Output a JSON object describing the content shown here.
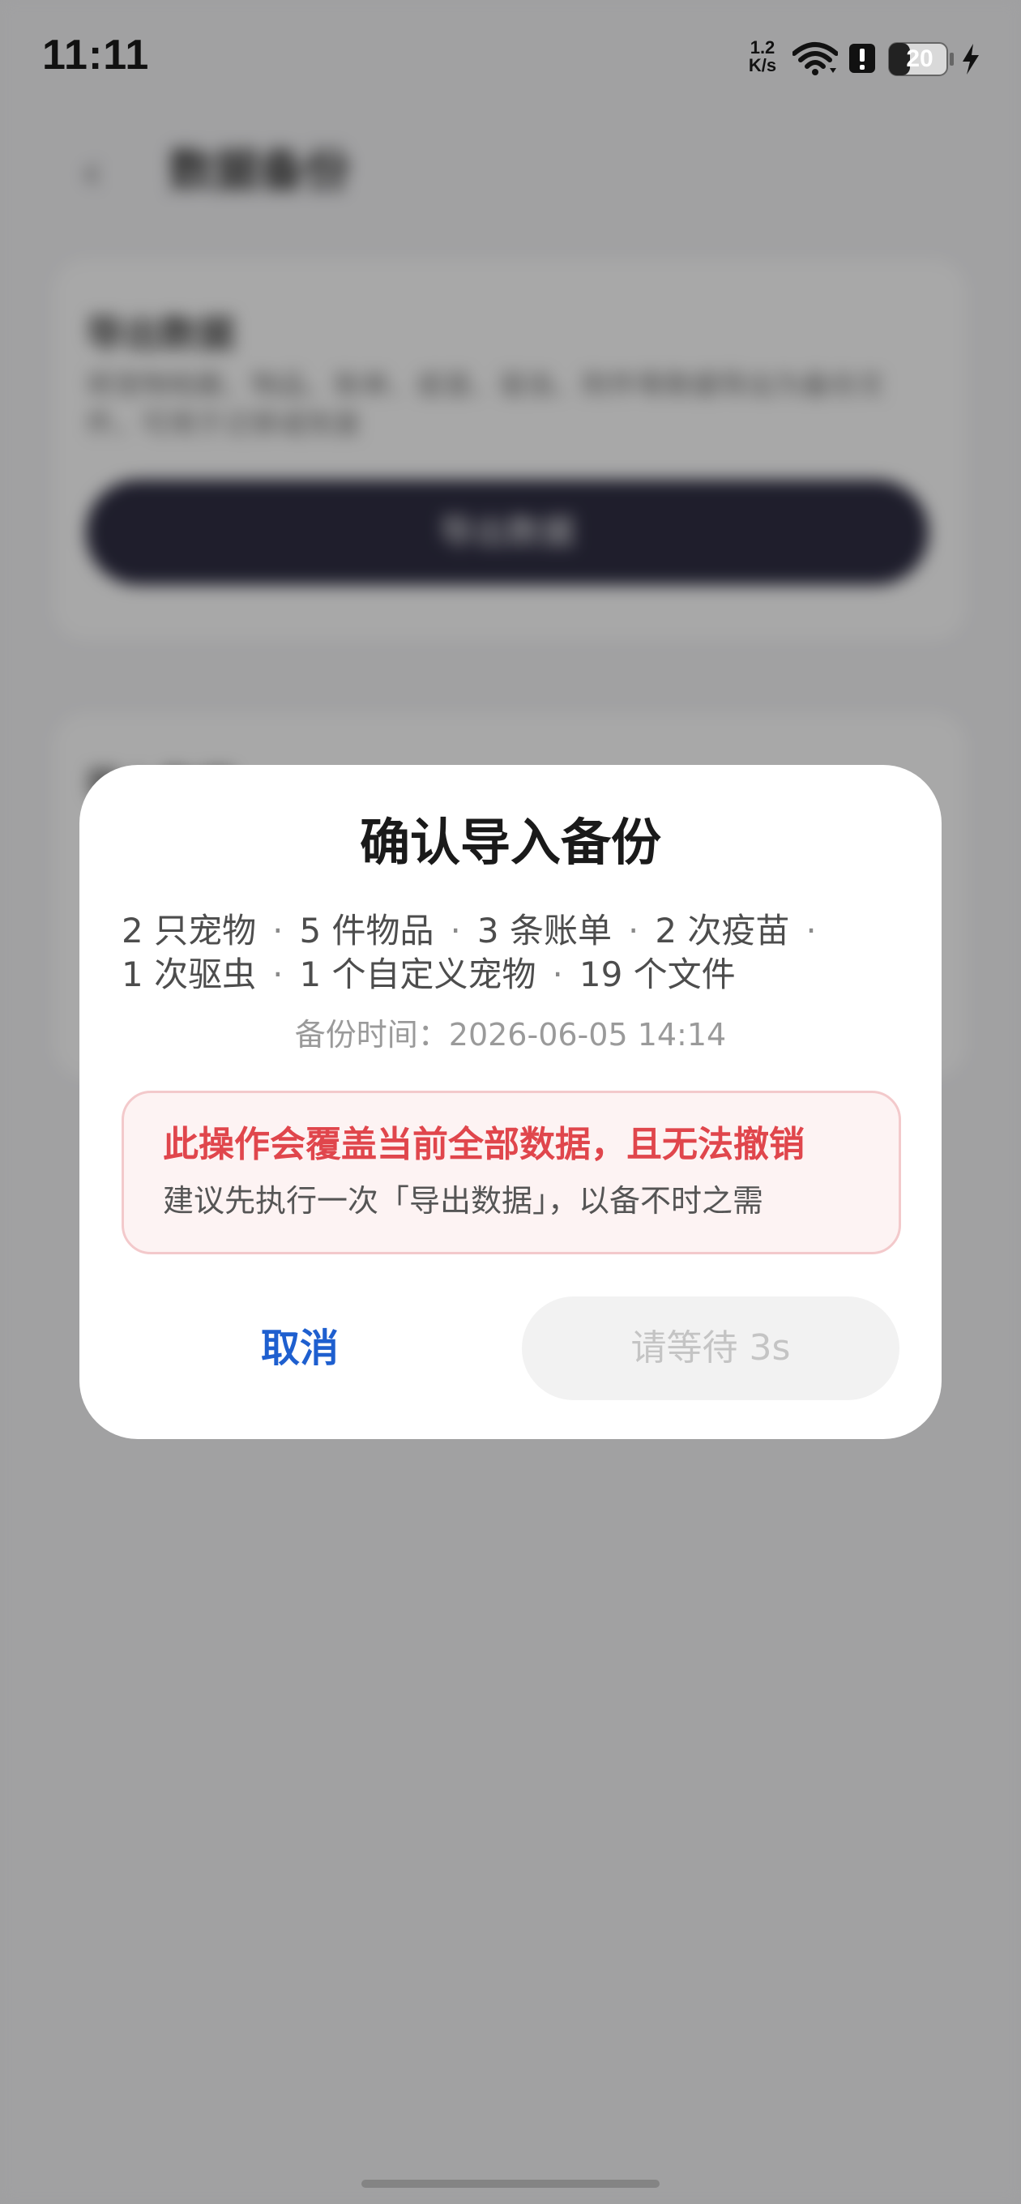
{
  "status_bar": {
    "time": "11:11",
    "net_speed_value": "1.2",
    "net_speed_unit": "K/s",
    "battery_level": "20",
    "icons": [
      "wifi-icon",
      "alert-icon",
      "battery-icon",
      "charging-icon"
    ]
  },
  "background": {
    "page_title": "数据备份",
    "export_card": {
      "title": "导出数据",
      "description": "将宠物档案、物品、账单、疫苗、驱虫、附件等数据导出为备份文件，可用于迁移或恢复",
      "button_label": "导出数据"
    },
    "import_card": {
      "title": "导入数据"
    }
  },
  "dialog": {
    "title": "确认导入备份",
    "summary_line1": [
      "2 只宠物",
      "5 件物品",
      "3 条账单",
      "2 次疫苗"
    ],
    "summary_line2": [
      "1 次驱虫",
      "1 个自定义宠物",
      "19 个文件"
    ],
    "separator": "·",
    "backup_time": "备份时间：2026-06-05 14:14",
    "warning": {
      "title": "此操作会覆盖当前全部数据，且无法撤销",
      "description": "建议先执行一次「导出数据」，以备不时之需"
    },
    "cancel_label": "取消",
    "confirm_label": "请等待 3s"
  },
  "colors": {
    "accent_blue": "#1e5fcf",
    "warning_red": "#e0464c",
    "warning_bg": "#fdf3f3",
    "warning_border": "#f3c9cb",
    "disabled_text": "#c4c4c4",
    "dark_button": "#2f2e43"
  }
}
